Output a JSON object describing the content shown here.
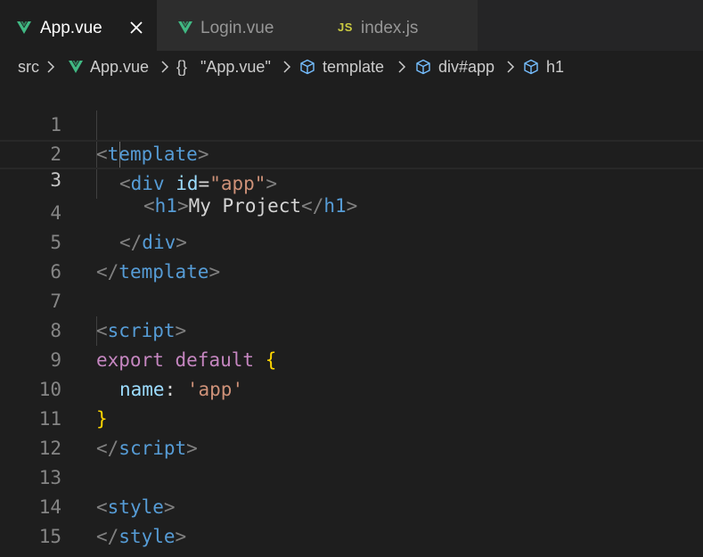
{
  "tabs": [
    {
      "label": "App.vue",
      "icon": "vue-icon",
      "active": true,
      "closable": true
    },
    {
      "label": "Login.vue",
      "icon": "vue-icon",
      "active": false
    },
    {
      "label": "index.js",
      "icon": "js-icon",
      "icon_text": "JS",
      "active": false
    }
  ],
  "breadcrumb": {
    "items": [
      "src",
      "App.vue",
      "\"App.vue\"",
      "template",
      "div#app",
      "h1"
    ],
    "braces_glyph": "{}"
  },
  "editor": {
    "current_line": 3,
    "lines": [
      {
        "n": "1"
      },
      {
        "n": "2"
      },
      {
        "n": "3"
      },
      {
        "n": "4"
      },
      {
        "n": "5"
      },
      {
        "n": "6"
      },
      {
        "n": "7"
      },
      {
        "n": "8"
      },
      {
        "n": "9"
      },
      {
        "n": "10"
      },
      {
        "n": "11"
      },
      {
        "n": "12"
      },
      {
        "n": "13"
      },
      {
        "n": "14"
      },
      {
        "n": "15"
      }
    ],
    "tokens": {
      "l1": {
        "lt": "<",
        "tag": "template",
        "gt": ">"
      },
      "l2": {
        "lt": "<",
        "tag": "div",
        "attr": "id",
        "eq": "=",
        "val": "\"app\"",
        "gt": ">"
      },
      "l3": {
        "lt": "<",
        "tag": "h1",
        "gt": ">",
        "text": "My Project",
        "lt2": "</",
        "tag2": "h1",
        "gt2": ">"
      },
      "l4": {
        "lt": "</",
        "tag": "div",
        "gt": ">"
      },
      "l5": {
        "lt": "</",
        "tag": "template",
        "gt": ">"
      },
      "l7": {
        "lt": "<",
        "tag": "script",
        "gt": ">"
      },
      "l8": {
        "kw1": "export",
        "sp": " ",
        "kw2": "default",
        "sp2": " ",
        "brace": "{"
      },
      "l9": {
        "prop": "name",
        "colon": ": ",
        "val": "'app'"
      },
      "l10": {
        "brace": "}"
      },
      "l11": {
        "lt": "</",
        "tag": "script",
        "gt": ">"
      },
      "l13": {
        "lt": "<",
        "tag": "style",
        "gt": ">"
      },
      "l14": {
        "lt": "</",
        "tag": "style",
        "gt": ">"
      }
    }
  },
  "colors": {
    "background": "#1e1e1e",
    "tab_bar": "#252526",
    "vue_green": "#41b883",
    "js_yellow": "#cbcb41",
    "tag_blue": "#569cd6",
    "string_orange": "#ce9178",
    "keyword_purple": "#c586c0",
    "brace_gold": "#ffd700"
  }
}
